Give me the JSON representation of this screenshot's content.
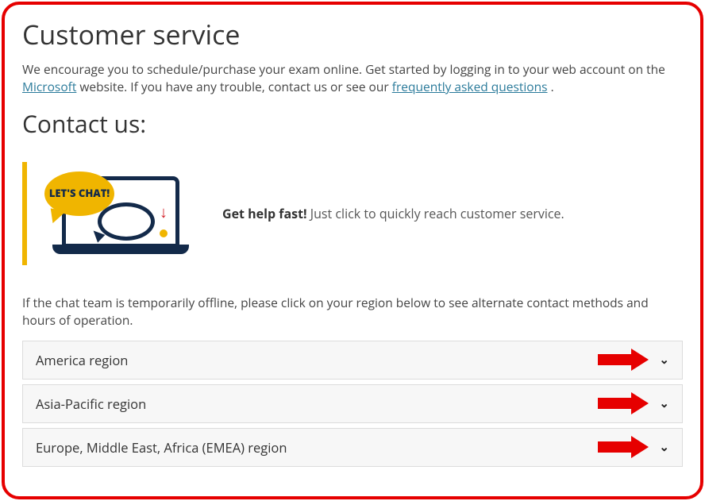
{
  "title": "Customer service",
  "intro": {
    "pre": "We encourage you to schedule/purchase your exam online. Get started by logging in to your web account on the ",
    "link1": "Microsoft",
    "mid": " website. If you have any trouble, contact us or see our ",
    "link2": "frequently asked questions",
    "post": "."
  },
  "contact_heading": "Contact us:",
  "chat": {
    "bubble_text": "LET'S CHAT!",
    "bold": "Get help fast!",
    "rest": " Just click to quickly reach customer service."
  },
  "offline_note": "If the chat team is temporarily offline, please click on your region below to see alternate contact methods and hours of operation.",
  "regions": {
    "r0": "America region",
    "r1": "Asia-Pacific region",
    "r2": "Europe, Middle East, Africa (EMEA) region"
  }
}
